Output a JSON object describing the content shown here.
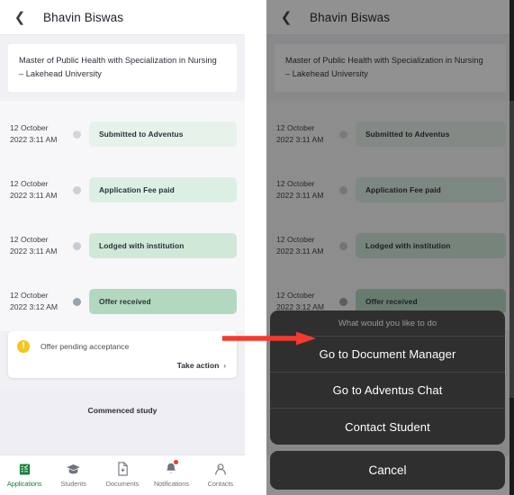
{
  "header": {
    "back_icon": "chevron-left-icon",
    "title": "Bhavin Biswas"
  },
  "course": {
    "line1": "Master of Public Health with Specialization in Nursing",
    "line2": "– Lakehead University"
  },
  "timeline": {
    "rows": [
      {
        "date_line1": "12 October",
        "date_line2": "2022 3:11 AM",
        "label": "Submitted to Adventus",
        "chip_color": "#e6f2ea",
        "dot_color": "#d2d6db"
      },
      {
        "date_line1": "12 October",
        "date_line2": "2022 3:11 AM",
        "label": "Application Fee paid",
        "chip_color": "#dcefe3",
        "dot_color": "#ccd1d7"
      },
      {
        "date_line1": "12 October",
        "date_line2": "2022 3:11 AM",
        "label": "Lodged with institution",
        "chip_color": "#cfe8d8",
        "dot_color": "#c6ccd2"
      },
      {
        "date_line1": "12 October",
        "date_line2": "2022 3:12 AM",
        "label": "Offer received",
        "chip_color": "#b2d9bf",
        "dot_color": "#9aa2ab"
      }
    ]
  },
  "pending": {
    "warn_icon": "exclamation-icon",
    "warn_glyph": "!",
    "text": "Offer pending acceptance",
    "action_label": "Take action",
    "action_chevron": "›"
  },
  "commenced": {
    "label": "Commenced study"
  },
  "bottom_nav": {
    "items": [
      {
        "label": "Applications",
        "icon": "applications-checklist-icon",
        "active": true,
        "badge": false
      },
      {
        "label": "Students",
        "icon": "graduation-cap-icon",
        "active": false,
        "badge": false
      },
      {
        "label": "Documents",
        "icon": "document-add-icon",
        "active": false,
        "badge": false
      },
      {
        "label": "Notifications",
        "icon": "bell-icon",
        "active": false,
        "badge": true
      },
      {
        "label": "Contacts",
        "icon": "contact-person-icon",
        "active": false,
        "badge": false
      }
    ]
  },
  "action_sheet": {
    "title": "What would you like to do",
    "options": [
      "Go to Document Manager",
      "Go to Adventus Chat",
      "Contact Student"
    ],
    "cancel_label": "Cancel"
  },
  "annotation": {
    "arrow_icon": "red-arrow-right-icon",
    "color": "#f4392f"
  },
  "colors": {
    "accent_green": "#17803d",
    "badge_red": "#ec3b2e",
    "warn_yellow": "#f5c518",
    "overlay": "rgba(10,10,12,.45)"
  }
}
